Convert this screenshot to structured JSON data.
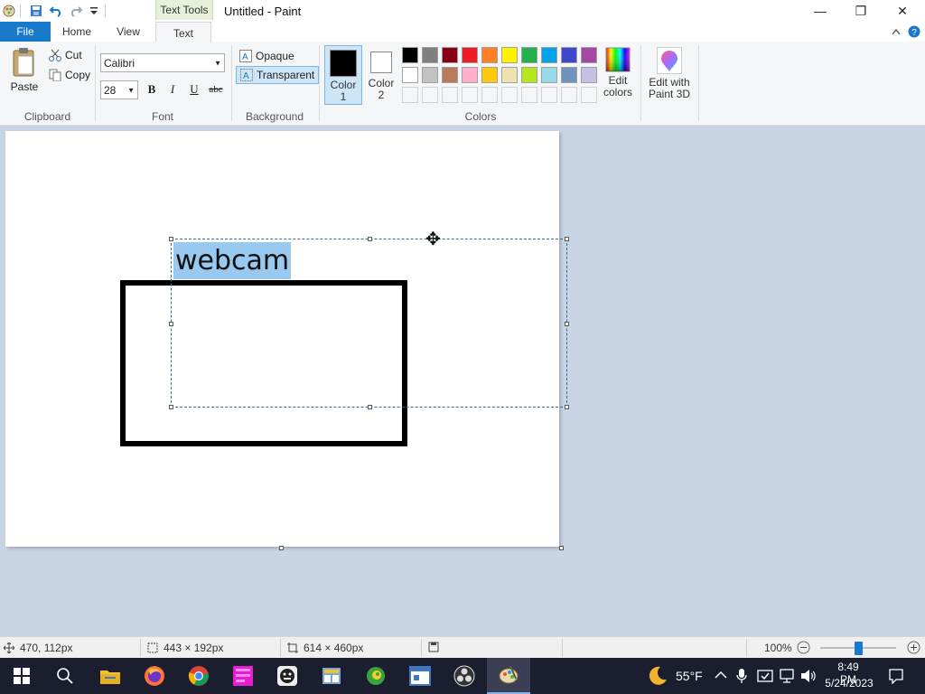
{
  "window": {
    "title": "Untitled - Paint",
    "context_tab": "Text Tools",
    "minimize_glyph": "—",
    "maximize_glyph": "❐",
    "close_glyph": "✕"
  },
  "ribbon_tabs": {
    "file": "File",
    "home": "Home",
    "view": "View",
    "text": "Text"
  },
  "clipboard": {
    "paste": "Paste",
    "cut": "Cut",
    "copy": "Copy",
    "group": "Clipboard"
  },
  "font": {
    "family": "Calibri",
    "size": "28",
    "bold": "B",
    "italic": "I",
    "underline": "U",
    "strike": "abc",
    "group": "Font"
  },
  "background": {
    "opaque": "Opaque",
    "transparent": "Transparent",
    "group": "Background"
  },
  "colors": {
    "color1_label": "Color\n1",
    "color2_label": "Color\n2",
    "color1_value": "#000000",
    "color2_value": "#ffffff",
    "edit_colors": "Edit colors",
    "edit_paint3d": "Edit with Paint 3D",
    "group": "Colors",
    "palette_row1": [
      "#000000",
      "#7f7f7f",
      "#880015",
      "#ed1c24",
      "#ff7f27",
      "#fff200",
      "#22b14c",
      "#00a2e8",
      "#3f48cc",
      "#a349a4"
    ],
    "palette_row2": [
      "#ffffff",
      "#c3c3c3",
      "#b97a57",
      "#ffaec9",
      "#ffc90e",
      "#efe4b0",
      "#b5e61d",
      "#99d9ea",
      "#7092be",
      "#c8bfe7"
    ],
    "palette_row3": [
      "#f5f6f7",
      "#f5f6f7",
      "#f5f6f7",
      "#f5f6f7",
      "#f5f6f7",
      "#f5f6f7",
      "#f5f6f7",
      "#f5f6f7",
      "#f5f6f7",
      "#f5f6f7"
    ]
  },
  "canvas": {
    "text_content": "webcam"
  },
  "statusbar": {
    "cursor_pos": "470, 112px",
    "selection_size": "443 × 192px",
    "canvas_size": "614 × 460px",
    "zoom": "100%",
    "zoom_fraction": 0.5
  },
  "taskbar": {
    "apps": [
      "start-icon",
      "search-icon",
      "file-explorer-icon",
      "firefox-icon",
      "chrome-icon",
      "app-pink-icon",
      "app-face-icon",
      "app-tool-icon",
      "app-green-icon",
      "app-window-icon",
      "obs-icon",
      "paint-icon"
    ],
    "temperature": "55°F",
    "time": "8:49 PM",
    "date": "5/24/2023"
  }
}
